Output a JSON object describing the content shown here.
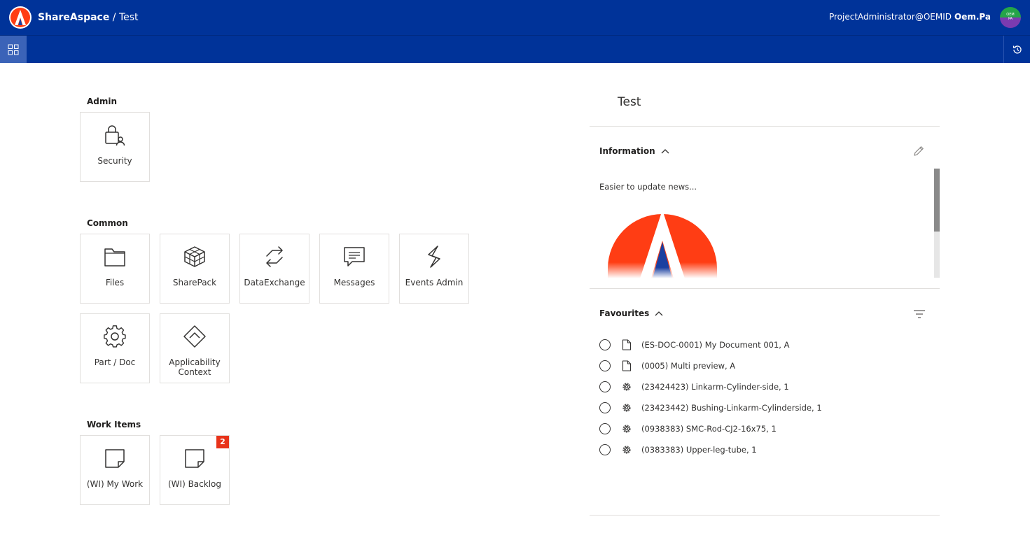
{
  "header": {
    "brand_name": "ShareAspace",
    "brand_sep": "/",
    "project": "Test",
    "user_email": "ProjectAdministrator@OEMID",
    "user_short": "Oem.Pa",
    "avatar_text_top": "OEM",
    "avatar_text_bottom": "PA"
  },
  "sections": {
    "admin": {
      "title": "Admin",
      "tiles": [
        {
          "label": "Security",
          "icon": "lock-user-icon"
        }
      ]
    },
    "common": {
      "title": "Common",
      "tiles": [
        {
          "label": "Files",
          "icon": "folder-icon"
        },
        {
          "label": "SharePack",
          "icon": "package-icon"
        },
        {
          "label": "DataExchange",
          "icon": "exchange-icon"
        },
        {
          "label": "Messages",
          "icon": "message-icon"
        },
        {
          "label": "Events Admin",
          "icon": "lightning-icon"
        },
        {
          "label": "Part / Doc",
          "icon": "gear-icon"
        },
        {
          "label": "Applicability Context",
          "icon": "diamond-icon"
        }
      ]
    },
    "work_items": {
      "title": "Work Items",
      "tiles": [
        {
          "label": "(WI) My Work",
          "icon": "note-icon"
        },
        {
          "label": "(WI) Backlog",
          "icon": "note-icon",
          "badge": "2"
        }
      ]
    }
  },
  "right": {
    "title": "Test",
    "information": {
      "title": "Information",
      "text": "Easier to update news..."
    },
    "favourites": {
      "title": "Favourites",
      "items": [
        {
          "text": "(ES-DOC-0001) My Document 001, A",
          "icon": "document-icon"
        },
        {
          "text": "(0005) Multi preview, A",
          "icon": "document-icon"
        },
        {
          "text": "(23424423) Linkarm-Cylinder-side, 1",
          "icon": "gear-icon"
        },
        {
          "text": "(23423442) Bushing-Linkarm-Cylinderside, 1",
          "icon": "gear-icon"
        },
        {
          "text": "(0938383) SMC-Rod-CJ2-16x75, 1",
          "icon": "gear-icon"
        },
        {
          "text": "(0383383) Upper-leg-tube, 1",
          "icon": "gear-icon"
        }
      ]
    }
  },
  "colors": {
    "header_bg": "#003399",
    "accent_red": "#e8331a",
    "logo_red": "#ff3d14",
    "logo_blue": "#1a3fa0"
  }
}
